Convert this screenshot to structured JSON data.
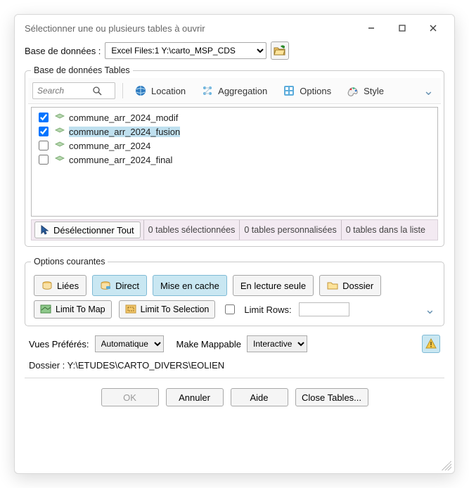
{
  "window": {
    "title": "Sélectionner une ou plusieurs tables à ouvrir"
  },
  "database": {
    "label": "Base de données :",
    "selected": "Excel Files:1 Y:\\carto_MSP_CDS"
  },
  "tables_group": {
    "legend": "Base de données Tables",
    "search_placeholder": "Search",
    "toolbar": {
      "location": "Location",
      "aggregation": "Aggregation",
      "options": "Options",
      "style": "Style"
    },
    "items": [
      {
        "name": "commune_arr_2024_modif",
        "checked": true,
        "selected": false
      },
      {
        "name": "commune_arr_2024_fusion",
        "checked": true,
        "selected": true
      },
      {
        "name": "commune_arr_2024",
        "checked": false,
        "selected": false
      },
      {
        "name": "commune_arr_2024_final",
        "checked": false,
        "selected": false
      }
    ],
    "deselect_all": "Désélectionner Tout",
    "stats": {
      "selected": "0 tables sélectionnées",
      "custom": "0 tables personnalisées",
      "inlist": "0 tables dans la liste"
    }
  },
  "options_group": {
    "legend": "Options courantes",
    "linked": "Liées",
    "direct": "Direct",
    "cache": "Mise en cache",
    "readonly": "En lecture seule",
    "folder": "Dossier",
    "limit_map": "Limit To Map",
    "limit_sel": "Limit To Selection",
    "limit_rows_label": "Limit Rows:",
    "limit_rows_value": "",
    "limit_rows_checked": false
  },
  "prefs": {
    "label": "Vues Préférés:",
    "auto": "Automatique",
    "make_mappable": "Make Mappable",
    "interactive": "Interactive"
  },
  "folder_line": "Dossier : Y:\\ETUDES\\CARTO_DIVERS\\EOLIEN",
  "footer": {
    "ok": "OK",
    "cancel": "Annuler",
    "help": "Aide",
    "close_tables": "Close Tables..."
  }
}
